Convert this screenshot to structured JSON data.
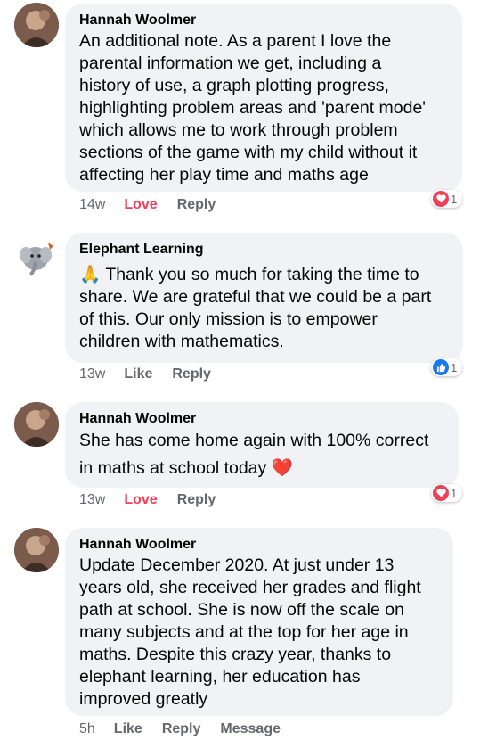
{
  "comments": [
    {
      "author": "Hannah Woolmer",
      "lines": [
        "An additional note.  As a parent I love the",
        "parental information we get, including a",
        "history of use, a graph plotting progress,",
        "highlighting problem areas and 'parent mode'",
        "which allows me to work through problem",
        "sections of the game with my child without it",
        "affecting her play time and maths age"
      ],
      "time": "14w",
      "action1": "Love",
      "action2": "Reply",
      "reaction_count": "1",
      "reaction_icon": "heart-icon"
    },
    {
      "author": "Elephant Learning",
      "lines": [
        "🙏 Thank you so much for taking the time to",
        "share. We are grateful that we could be a part",
        "of this. Our only mission is to empower",
        "children with mathematics."
      ],
      "time": "13w",
      "action1": "Like",
      "action2": "Reply",
      "reaction_count": "1",
      "reaction_icon": "thumbs-up-icon"
    },
    {
      "author": "Hannah Woolmer",
      "lines": [
        "She has come home again with 100% correct",
        "in maths at school today ❤️"
      ],
      "time": "13w",
      "action1": "Love",
      "action2": "Reply",
      "reaction_count": "1",
      "reaction_icon": "heart-icon"
    },
    {
      "author": "Hannah Woolmer",
      "lines": [
        "Update December 2020.  At just under 13",
        "years old, she received her grades and flight",
        "path at school.  She is now off the scale on",
        "many subjects and at the top for her age in",
        "maths.  Despite this crazy year, thanks to",
        "elephant learning, her education has",
        "improved greatly"
      ],
      "time": "5h",
      "action1": "Like",
      "action2": "Reply",
      "action3": "Message"
    }
  ],
  "colors": {
    "bubble": "#f0f2f5",
    "love": "#f33e58",
    "like": "#1877f2",
    "meta": "#65676b"
  }
}
